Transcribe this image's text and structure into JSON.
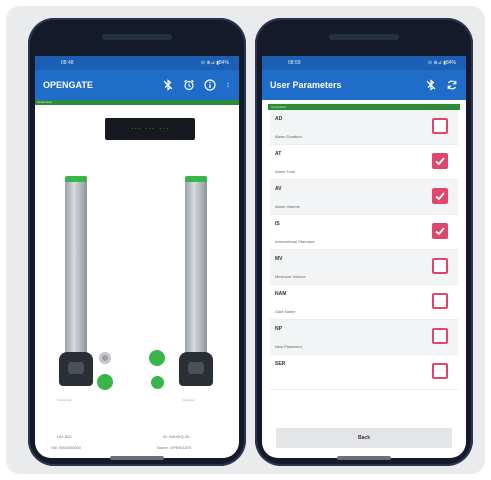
{
  "left_phone": {
    "status": {
      "time": "08:48",
      "indicators": "⊙ ⊕⊿ ▮84%"
    },
    "appbar": {
      "title": "OPENGATE",
      "icons": [
        "bluetooth-off-icon",
        "alarm-icon",
        "info-icon",
        "more-vert-icon"
      ]
    },
    "connection_text": "Connected",
    "display_text": "--- --- ---",
    "left_pedestal_label": "Transmitter",
    "right_pedestal_label": "Receiver",
    "footer": {
      "left_top": "LW: 820",
      "right_top": "ID: MAXEQ-26",
      "left_bottom": "SN: 0000000000",
      "right_bottom": "Name: OPENGATE"
    },
    "colors": {
      "led_on": "#39b54a",
      "led_off": "#9a9ea3"
    }
  },
  "right_phone": {
    "status": {
      "time": "08:59",
      "indicators": "⊙ ⊕⊿ ▮84%"
    },
    "appbar": {
      "title": "User Parameters",
      "icons": [
        "bluetooth-off-icon",
        "refresh-icon"
      ]
    },
    "strip_text": "Connected",
    "params": [
      {
        "code": "AD",
        "desc": "Alarm Duration",
        "checked": false
      },
      {
        "code": "AT",
        "desc": "Alarm Tone",
        "checked": true
      },
      {
        "code": "AV",
        "desc": "Alarm Volume",
        "checked": true
      },
      {
        "code": "IS",
        "desc": "International Standard",
        "checked": true
      },
      {
        "code": "MV",
        "desc": "Minimum Volume",
        "checked": false
      },
      {
        "code": "NAM",
        "desc": "Gate Name",
        "checked": false
      },
      {
        "code": "NP",
        "desc": "New Password",
        "checked": false
      },
      {
        "code": "SER",
        "desc": "",
        "checked": false
      }
    ],
    "back_label": "Back",
    "colors": {
      "checkbox": "#e0456d"
    }
  }
}
